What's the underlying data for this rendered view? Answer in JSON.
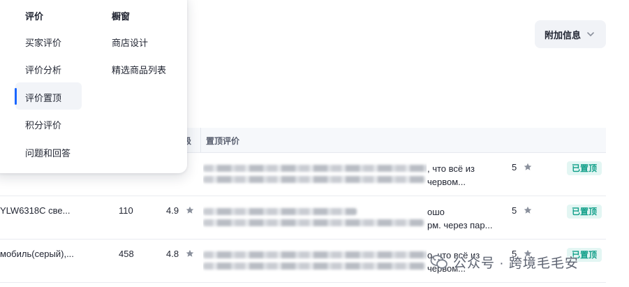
{
  "toolbar": {
    "attach_info_label": "附加信息"
  },
  "table": {
    "headers": {
      "level": "级",
      "pinned_review": "置顶评价"
    },
    "rows": [
      {
        "name": "",
        "count": "",
        "rating": "",
        "review_tail": ", что всё из\nчервом...",
        "score": "5",
        "badge": "已置顶"
      },
      {
        "name": "YLW6318C све...",
        "count": "110",
        "rating": "4.9",
        "review_tail": "ошо\nрм. через пар...",
        "score": "5",
        "badge": "已置顶"
      },
      {
        "name": "мобиль(серый),...",
        "count": "458",
        "rating": "4.8",
        "review_tail": "о, что всё из\nчервом...",
        "score": "5",
        "badge": "已置顶"
      }
    ]
  },
  "menu": {
    "col1": {
      "heading": "评价",
      "items": [
        "买家评价",
        "评价分析",
        "评价置顶",
        "积分评价",
        "问题和回答"
      ],
      "active_index": 2
    },
    "col2": {
      "heading": "橱窗",
      "items": [
        "商店设计",
        "精选商品列表"
      ]
    }
  },
  "watermark": {
    "text": "公众号 · 跨境毛毛安"
  },
  "colors": {
    "accent": "#1a66ff",
    "badge_bg": "#e3f6f3",
    "badge_text": "#12a08a",
    "star": "#8a909c"
  },
  "icons": {
    "chevron": "chevron-down-icon",
    "star": "star-icon",
    "watermark": "wechat-icon"
  }
}
